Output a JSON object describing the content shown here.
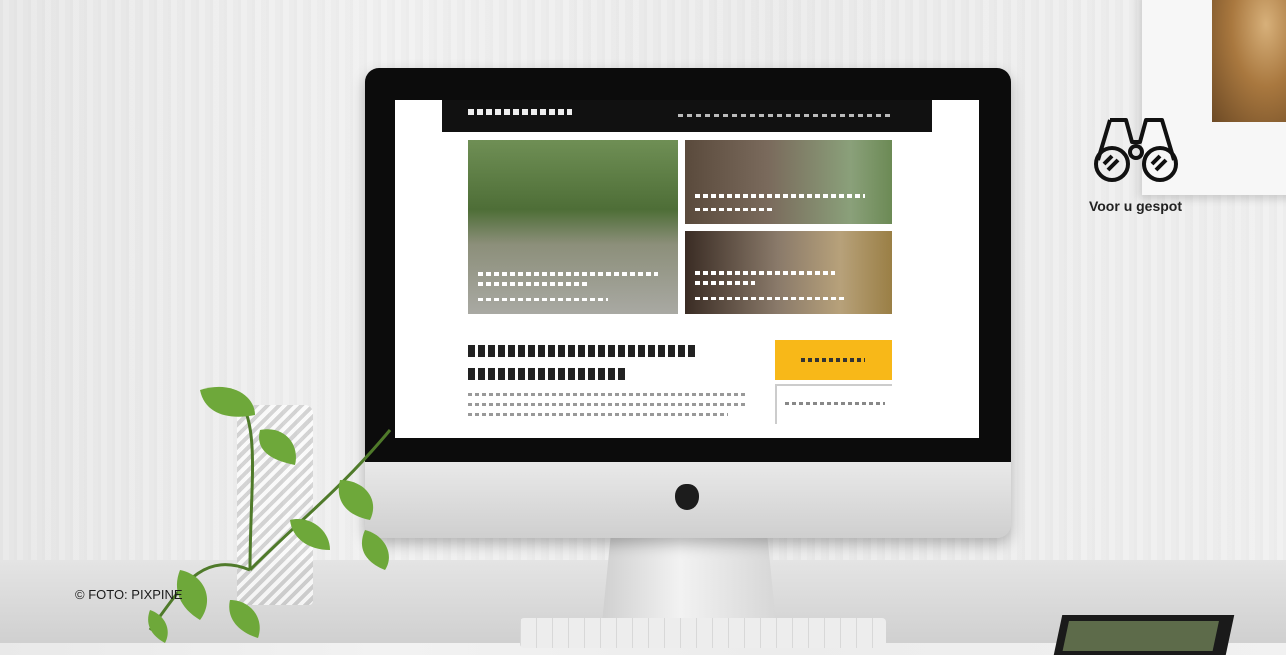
{
  "spot": {
    "label": "Voor u gespot",
    "icon": "binoculars-icon"
  },
  "credit": "© FOTO: PIXPINE",
  "colors": {
    "accent": "#f8b818",
    "nav": "#111111"
  }
}
